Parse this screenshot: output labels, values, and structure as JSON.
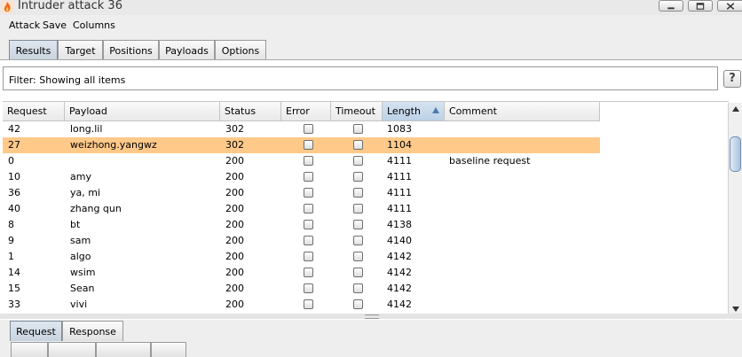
{
  "window": {
    "title": "Intruder attack 36",
    "icon": "burp-flame-icon",
    "controls": [
      "minimize-icon",
      "maximize-icon",
      "close-icon"
    ]
  },
  "menu": [
    "Attack",
    "Save",
    "Columns"
  ],
  "tabs": [
    "Results",
    "Target",
    "Positions",
    "Payloads",
    "Options"
  ],
  "active_tab": "Results",
  "filter": {
    "text": "Filter:  Showing all items",
    "help": "?"
  },
  "table": {
    "columns": [
      "Request",
      "Payload",
      "Status",
      "Error",
      "Timeout",
      "Length",
      "Comment"
    ],
    "sorted_column": "Length",
    "sort_direction": "ascending",
    "rows": [
      {
        "request": "42",
        "payload": "long.lil",
        "status": "302",
        "length": "1083",
        "comment": ""
      },
      {
        "request": "27",
        "payload": "weizhong.yangwz",
        "status": "302",
        "length": "1104",
        "comment": "",
        "selected": true
      },
      {
        "request": "0",
        "payload": "",
        "status": "200",
        "length": "4111",
        "comment": "baseline request"
      },
      {
        "request": "10",
        "payload": "amy",
        "status": "200",
        "length": "4111",
        "comment": ""
      },
      {
        "request": "36",
        "payload": "ya, mi",
        "status": "200",
        "length": "4111",
        "comment": ""
      },
      {
        "request": "40",
        "payload": "zhang qun",
        "status": "200",
        "length": "4111",
        "comment": ""
      },
      {
        "request": "8",
        "payload": "bt",
        "status": "200",
        "length": "4138",
        "comment": ""
      },
      {
        "request": "9",
        "payload": "sam",
        "status": "200",
        "length": "4140",
        "comment": ""
      },
      {
        "request": "1",
        "payload": "algo",
        "status": "200",
        "length": "4142",
        "comment": ""
      },
      {
        "request": "14",
        "payload": "wsim",
        "status": "200",
        "length": "4142",
        "comment": ""
      },
      {
        "request": "15",
        "payload": "Sean",
        "status": "200",
        "length": "4142",
        "comment": ""
      },
      {
        "request": "33",
        "payload": "vivi",
        "status": "200",
        "length": "4142",
        "comment": ""
      }
    ]
  },
  "bottom_tabs": [
    "Request",
    "Response"
  ],
  "active_bottom_tab": "Request",
  "colors": {
    "selected_row": "#ffc98a",
    "sorted_header": "#c7d9ec",
    "active_tab": "#d3dde8",
    "flame": "#f26b1d"
  }
}
